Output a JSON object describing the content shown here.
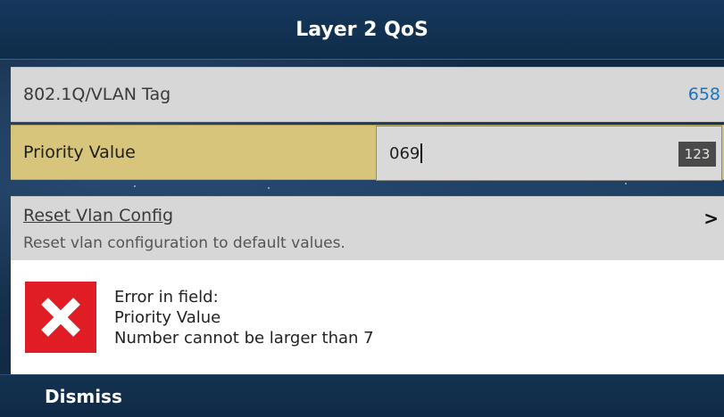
{
  "header": {
    "title": "Layer 2 QoS"
  },
  "list": {
    "vlan_tag": {
      "label": "802.1Q/VLAN Tag",
      "value": "658"
    },
    "priority": {
      "label": "Priority Value",
      "input_value": "069",
      "input_mode_badge": "123"
    },
    "reset": {
      "title": "Reset Vlan Config",
      "description": "Reset vlan configuration to default values.",
      "chevron": ">"
    }
  },
  "error": {
    "icon": "error-x-icon",
    "icon_color": "#e01c24",
    "lines": [
      "Error in field:",
      "Priority Value",
      "Number cannot be larger than 7"
    ]
  },
  "footer": {
    "dismiss_label": "Dismiss"
  },
  "colors": {
    "selected_row": "#d6c57a",
    "vlan_value": "#1a73c2",
    "header_bg": "#0f2c4a"
  }
}
